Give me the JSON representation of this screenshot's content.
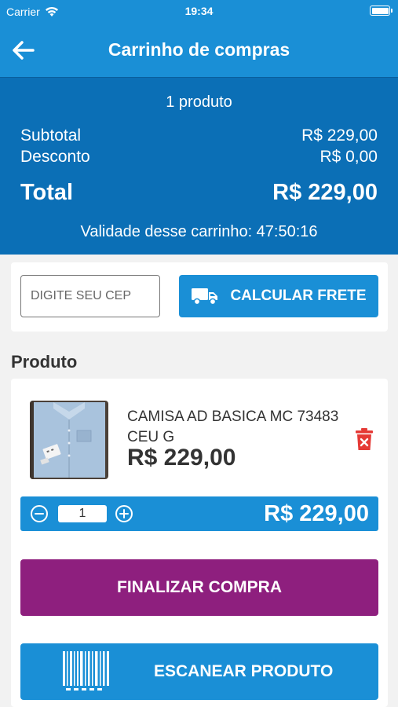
{
  "status_bar": {
    "carrier": "Carrier",
    "time": "19:34"
  },
  "nav": {
    "title": "Carrinho de compras",
    "back_icon": "arrow-left-icon"
  },
  "summary": {
    "count": "1 produto",
    "subtotal_label": "Subtotal",
    "subtotal_value": "R$ 229,00",
    "discount_label": "Desconto",
    "discount_value": "R$ 0,00",
    "total_label": "Total",
    "total_value": "R$ 229,00",
    "validity": "Validade desse carrinho: 47:50:16"
  },
  "shipping": {
    "cep_placeholder": "DIGITE SEU CEP",
    "cep_value": "",
    "calc_label": "CALCULAR FRETE",
    "calc_icon": "truck-icon"
  },
  "products_section": {
    "title": "Produto",
    "items": [
      {
        "name": "CAMISA AD BASICA MC 73483 CEU G",
        "price": "R$ 229,00",
        "quantity": "1",
        "line_total": "R$ 229,00",
        "delete_icon": "trash-icon"
      }
    ]
  },
  "actions": {
    "finalize_label": "FINALIZAR COMPRA",
    "scan_label": "ESCANEAR PRODUTO",
    "scan_icon": "barcode-icon"
  },
  "colors": {
    "header_blue": "#1a8fd6",
    "summary_blue": "#0b6fb6",
    "finalize_purple": "#8e1f7e",
    "delete_red": "#e53935"
  }
}
